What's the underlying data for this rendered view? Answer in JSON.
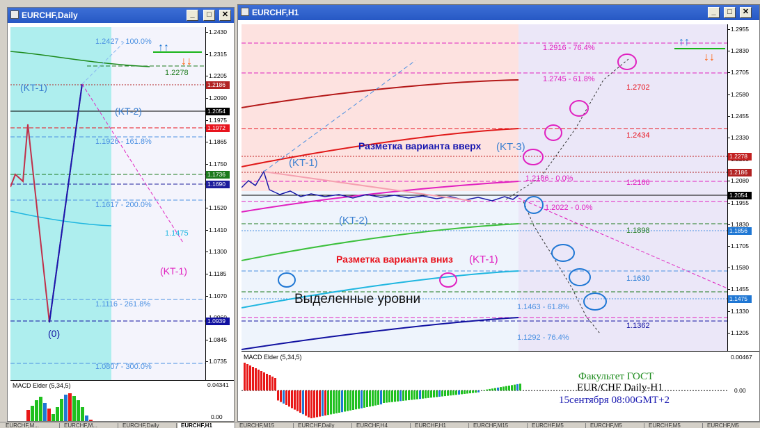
{
  "windows": {
    "daily": {
      "title": "EURCHF,Daily",
      "axis_ticks": [
        "1.2430",
        "1.2315",
        "1.2205",
        "1.2090",
        "1.1975",
        "1.1865",
        "1.1750",
        "1.1635",
        "1.1520",
        "1.1410",
        "1.1300",
        "1.1185",
        "1.1070",
        "1.0960",
        "1.0845",
        "1.0735"
      ],
      "price_tags": [
        {
          "text": "1.2186",
          "color": "#b22222"
        },
        {
          "text": "1.2054",
          "color": "#000000"
        },
        {
          "text": "1.1972",
          "color": "#e8141e"
        },
        {
          "text": "1.1736",
          "color": "#1c7a1c"
        },
        {
          "text": "1.1690",
          "color": "#1c1c9c"
        },
        {
          "text": "1.0939",
          "color": "#1010a0"
        }
      ],
      "labels": {
        "fib100": "1.2427 - 100.0%",
        "lvl_green": "1.2278",
        "fib1618": "1.1926 - 161.8%",
        "fib200": "1.1617 - 200.0%",
        "lvl_cyan": "1.1475",
        "fib2618": "1.1116 - 261.8%",
        "fib300": "1.0807 - 300.0%",
        "kt1": "(KT-1)",
        "kt2": "(KT-2)",
        "kt1_pink": "(KT-1)",
        "zero": "(0)"
      },
      "macd": {
        "title": "MACD Elder (5,34,5)",
        "top": "0.04341",
        "zero": "0.00"
      }
    },
    "h1": {
      "title": "EURCHF,H1",
      "axis_ticks": [
        "1.2955",
        "1.2830",
        "1.2705",
        "1.2580",
        "1.2455",
        "1.2330",
        "1.2205",
        "1.2080",
        "1.1955",
        "1.1830",
        "1.1705",
        "1.1580",
        "1.1455",
        "1.1330",
        "1.1205"
      ],
      "price_tags": [
        {
          "text": "1.2278",
          "color": "#c22020"
        },
        {
          "text": "1.2186",
          "color": "#b22222"
        },
        {
          "text": "1.2054",
          "color": "#000000"
        },
        {
          "text": "1.1856",
          "color": "#1f77d4"
        },
        {
          "text": "1.1475",
          "color": "#1f77d4"
        }
      ],
      "labels": {
        "fib764_up": "1.2916 - 76.4%",
        "fib618_up": "1.2745 - 61.8%",
        "l2702": "1.2702",
        "l2434": "1.2434",
        "l2166": "1.2166",
        "fib0_up": "1.2186 - 0.0%",
        "fib0_dn": "1.2022 - 0.0%",
        "l1898": "1.1898",
        "l1630": "1.1630",
        "fib618_dn": "1.1463 - 61.8%",
        "l1362": "1.1362",
        "fib764_dn": "1.1292 - 76.4%",
        "markup_up": "Разметка варианта вверх",
        "markup_up_kt": "(KT-3)",
        "markup_down": "Разметка варианта вниз",
        "markup_down_kt": "(KT-1)",
        "kt1": "(KT-1)",
        "kt2": "(KT-2)",
        "highlighted": "Выделенные уровни"
      },
      "macd": {
        "title": "MACD Elder (5,34,5)",
        "top": "0.00467",
        "zero": "0.00"
      },
      "caption": {
        "line1": "Факультет ГОСТ",
        "line2": "EUR/CHF Daily-H1",
        "line3": "15сентября 08:00GMT+2"
      }
    }
  },
  "tabs": [
    "EURCHF,M...",
    "EURCHF,M...",
    "EURCHF,Daily",
    "EURCHF,H1",
    "EURCHF,M15",
    "EURCHF,Daily",
    "EURCHF,H4",
    "EURCHF,H1",
    "EURCHF,M15",
    "EURCHF,M5",
    "EURCHF,M5",
    "EURCHF,M5",
    "EURCHF,M5"
  ],
  "colors": {
    "title_bar": "#2758c4",
    "daily_bg": "#aeeeee",
    "h1_left_bg": "#fde2e0",
    "h1_right_bg": "#ebe7f8",
    "fib_pink": "#e020c0",
    "level_red": "#e8141e",
    "level_blue": "#4a90e2"
  }
}
